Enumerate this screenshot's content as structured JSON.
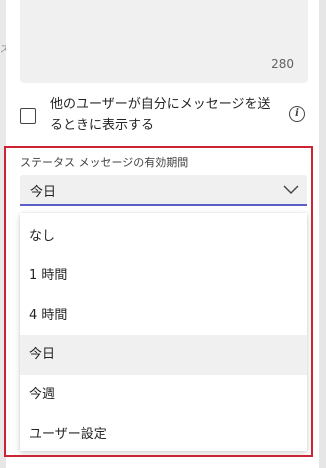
{
  "message_box": {
    "char_count": "280"
  },
  "show_message": {
    "checked": false,
    "label": "他のユーザーが自分にメッセージを送るときに表示する",
    "info_icon": "info-icon"
  },
  "status_expiry": {
    "label": "ステータス メッセージの有効期間",
    "selected": "今日",
    "options": [
      "なし",
      "1 時間",
      "4 時間",
      "今日",
      "今週",
      "ユーザー設定"
    ],
    "selected_index": 3,
    "accent_color": "#5b5fc7"
  },
  "highlight_color": "#cc2432"
}
